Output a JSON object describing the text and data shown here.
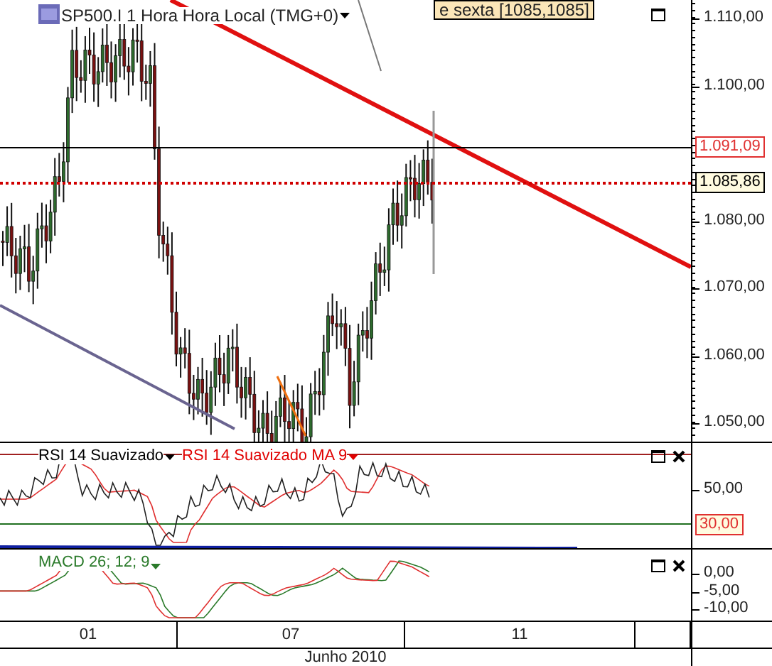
{
  "main_panel": {
    "title": "SP500.I 1 Hora Hora Local (TMG+0)",
    "tooltip": "e sexta [1085,1085]",
    "price_axis": [
      "1.110,00",
      "1.100,00",
      "1.080,00",
      "1.070,00",
      "1.060,00",
      "1.050,00"
    ],
    "price_markers": [
      {
        "label": "1.091,09",
        "kind": "line"
      },
      {
        "label": "1.085,86",
        "kind": "last"
      }
    ]
  },
  "rsi_panel": {
    "legend": [
      {
        "label": "RSI 14 Suavizado",
        "color": "#000000"
      },
      {
        "label": "RSI 14 Suavizado MA 9",
        "color": "#e00000"
      }
    ],
    "axis_labels": [
      "50,00"
    ],
    "level_marker": "30,00"
  },
  "macd_panel": {
    "legend": "MACD 26; 12; 9",
    "axis_labels": [
      "0,00",
      "-5,00",
      "-10,00"
    ]
  },
  "time_axis": {
    "days": [
      "01",
      "07",
      "11"
    ],
    "month": "Junho 2010"
  }
}
